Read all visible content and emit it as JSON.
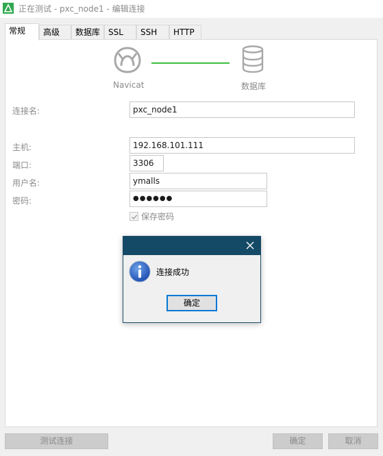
{
  "window": {
    "title": "正在测试 - pxc_node1 - 编辑连接",
    "icon": "navicat-leaf-icon",
    "accent": "#2fa84f"
  },
  "tabs": [
    {
      "label": "常规",
      "active": true
    },
    {
      "label": "高级",
      "active": false
    },
    {
      "label": "数据库",
      "active": false
    },
    {
      "label": "SSL",
      "active": false
    },
    {
      "label": "SSH",
      "active": false
    },
    {
      "label": "HTTP",
      "active": false
    }
  ],
  "diagram": {
    "source_label": "Navicat",
    "target_label": "数据库",
    "line_color": "#3cbf3c"
  },
  "form": {
    "connection_name": {
      "label": "连接名:",
      "value": "pxc_node1"
    },
    "host": {
      "label": "主机:",
      "value": "192.168.101.111"
    },
    "port": {
      "label": "端口:",
      "value": "3306"
    },
    "username": {
      "label": "用户名:",
      "value": "ymalls"
    },
    "password": {
      "label": "密码:",
      "value": "●●●●●●"
    },
    "save_password": {
      "label": "保存密码",
      "checked": true
    }
  },
  "dialog": {
    "message": "连接成功",
    "ok_label": "确定",
    "title_color": "#154a66"
  },
  "footer": {
    "test_label": "测试连接",
    "ok_label": "确定",
    "cancel_label": "取消"
  }
}
